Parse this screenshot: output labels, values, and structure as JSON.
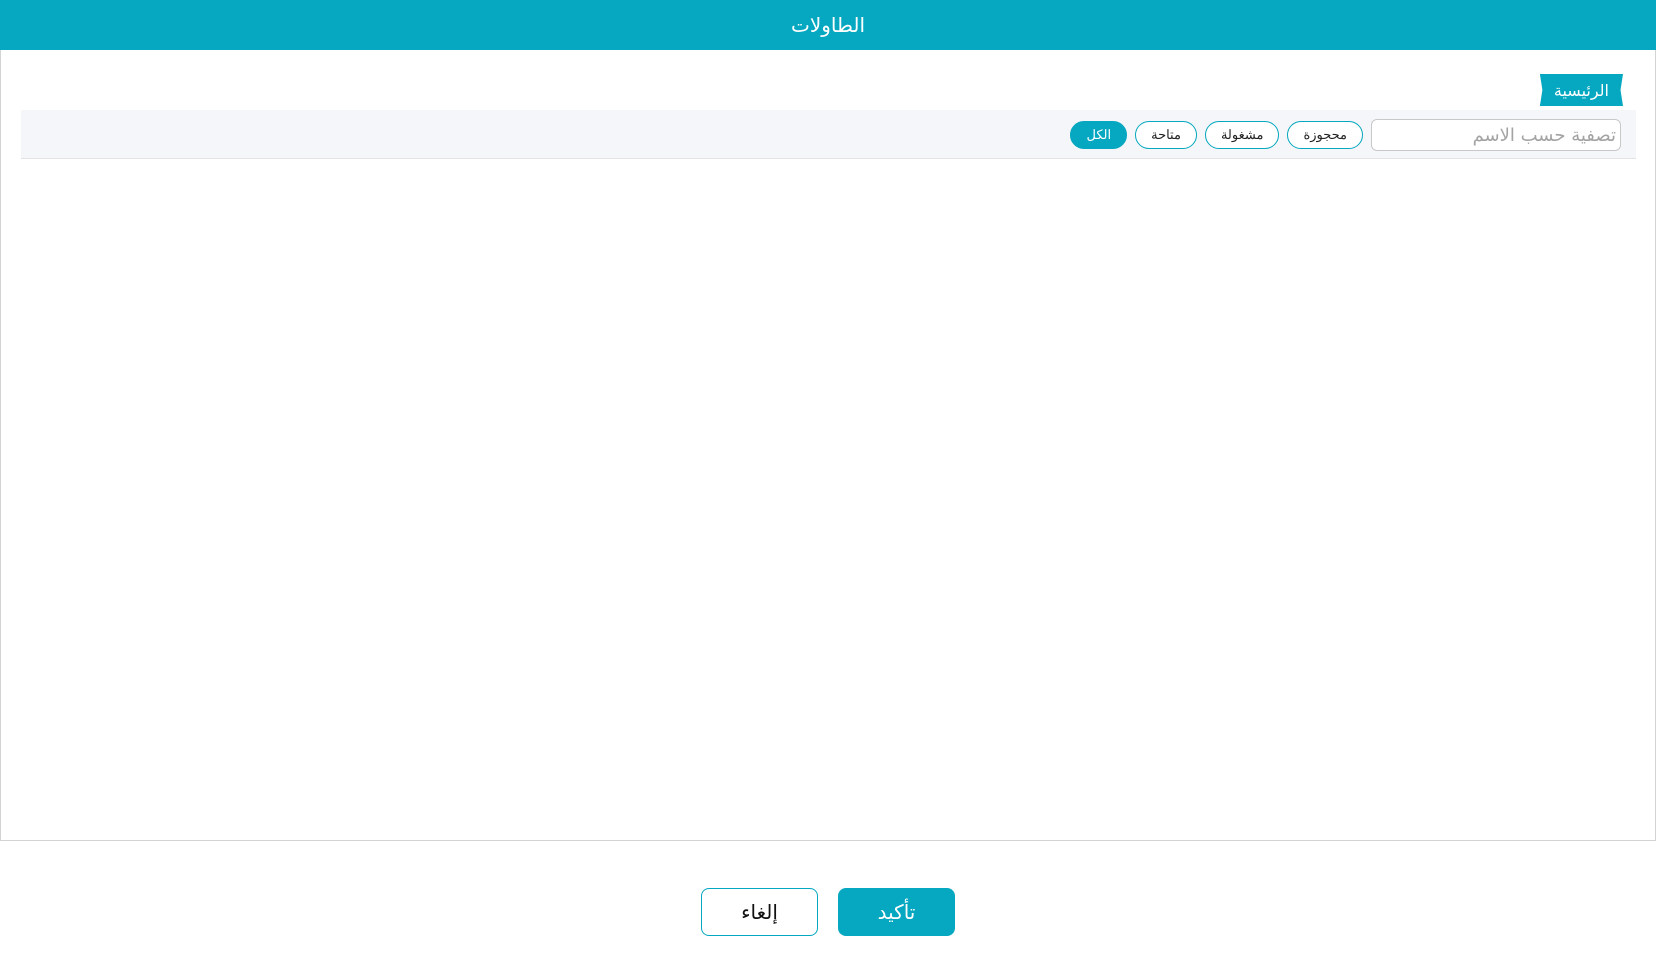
{
  "header": {
    "title": "الطاولات"
  },
  "breadcrumb": {
    "home": "الرئيسية"
  },
  "filters": {
    "all": "الكل",
    "available": "متاحة",
    "occupied": "مشغولة",
    "reserved": "محجوزة",
    "active": "all"
  },
  "search": {
    "placeholder": "تصفية حسب الاسم",
    "value": ""
  },
  "footer": {
    "confirm_label": "تأكيد",
    "cancel_label": "إلغاء"
  },
  "colors": {
    "accent": "#06a7c0"
  }
}
